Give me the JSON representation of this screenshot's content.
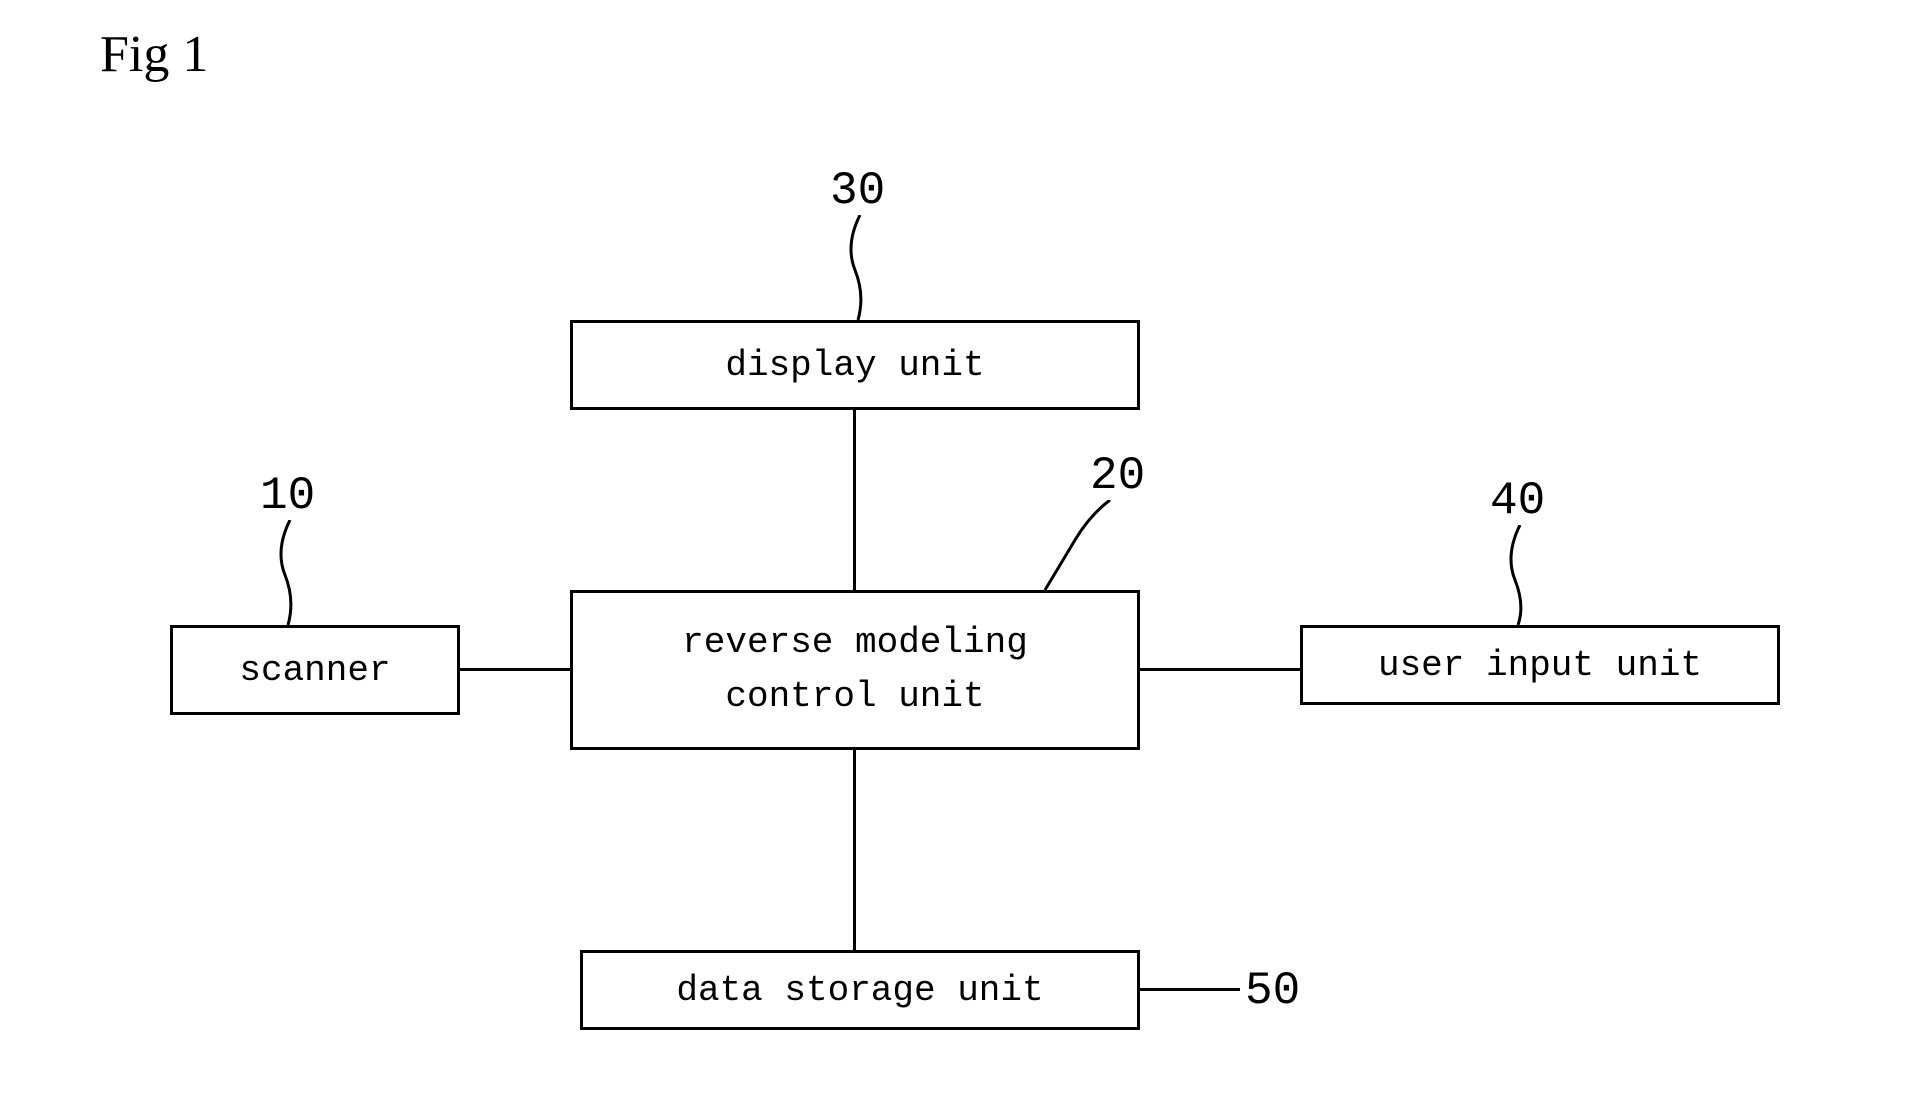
{
  "figure_label": "Fig 1",
  "blocks": {
    "scanner": {
      "label": "scanner",
      "ref": "10"
    },
    "control": {
      "label": "reverse modeling\ncontrol unit",
      "ref": "20"
    },
    "display": {
      "label": "display unit",
      "ref": "30"
    },
    "userinput": {
      "label": "user input unit",
      "ref": "40"
    },
    "storage": {
      "label": "data storage unit",
      "ref": "50"
    }
  }
}
